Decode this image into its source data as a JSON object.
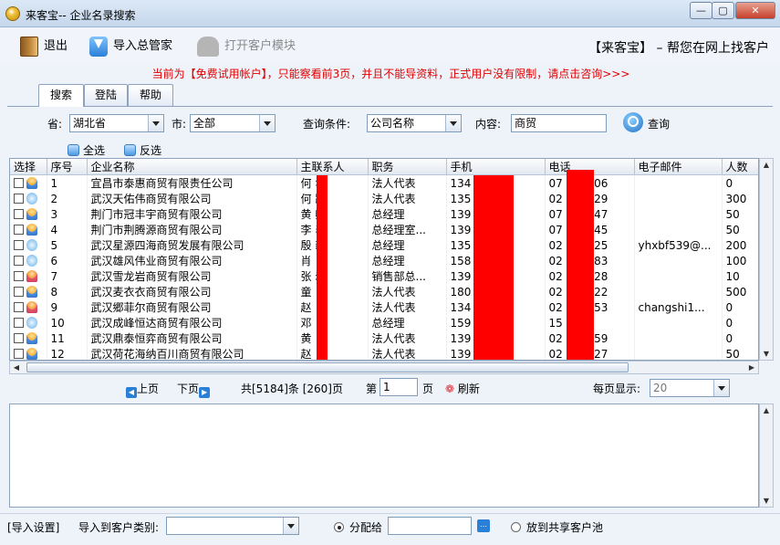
{
  "window": {
    "title": "来客宝-- 企业名录搜索",
    "min_label": "—",
    "max_label": "▢",
    "close_label": "✕"
  },
  "toolbar": {
    "exit_label": "退出",
    "import_label": "导入总管家",
    "open_module_label": "打开客户模块",
    "slogan": "【来客宝】 –  帮您在网上找客户"
  },
  "notice": "当前为【免费试用帐户】，只能察看前3页，并且不能导资料，正式用户没有限制，请点击咨询>>>",
  "tabs": [
    {
      "label": "搜索",
      "active": true
    },
    {
      "label": "登陆",
      "active": false
    },
    {
      "label": "帮助",
      "active": false
    }
  ],
  "search": {
    "province_label": "省:",
    "province_value": "湖北省",
    "city_label": "市:",
    "city_value": "全部",
    "condition_label": "查询条件:",
    "condition_value": "公司名称",
    "content_label": "内容:",
    "content_value": "商贸",
    "search_button": "查询",
    "select_all": "全选",
    "invert_select": "反选"
  },
  "grid": {
    "columns": [
      "选择",
      "序号",
      "企业名称",
      "主联系人",
      "职务",
      "手机",
      "电话",
      "电子邮件",
      "人数"
    ],
    "rows": [
      {
        "icon": "user",
        "no": "1",
        "name": "宜昌市泰惠商贸有限责任公司",
        "contact": "何   华",
        "title": "法人代表",
        "mobile": "134            23",
        "phone": "07            282106",
        "email": "",
        "count": "0"
      },
      {
        "icon": "star",
        "no": "2",
        "name": "武汉天佑伟商贸有限公司",
        "contact": "何   路",
        "title": "法人代表",
        "mobile": "135            83",
        "phone": "02            119329",
        "email": "",
        "count": "300"
      },
      {
        "icon": "user",
        "no": "3",
        "name": "荆门市冠丰宇商贸有限公司",
        "contact": "黄   卿",
        "title": "总经理",
        "mobile": "139            76",
        "phone": "07            211347",
        "email": "",
        "count": "50"
      },
      {
        "icon": "user",
        "no": "4",
        "name": "荆门市荆腾源商贸有限公司",
        "contact": "李   表",
        "title": "总经理室...",
        "mobile": "139            68",
        "phone": "07            219845",
        "email": "",
        "count": "50"
      },
      {
        "icon": "star",
        "no": "5",
        "name": "武汉星源四海商贸发展有限公司",
        "contact": "殷   新",
        "title": "总经理",
        "mobile": "135            23",
        "phone": "02            158925",
        "email": "yhxbf539@...",
        "count": "200"
      },
      {
        "icon": "star",
        "no": "6",
        "name": "武汉雄风伟业商贸有限公司",
        "contact": "肖",
        "title": "总经理",
        "mobile": "158            02",
        "phone": "02            252183",
        "email": "",
        "count": "100"
      },
      {
        "icon": "female",
        "no": "7",
        "name": "武汉雪龙岩商贸有限公司",
        "contact": "张   岩",
        "title": "销售部总...",
        "mobile": "139            14",
        "phone": "02            010528",
        "email": "",
        "count": "10"
      },
      {
        "icon": "user",
        "no": "8",
        "name": "武汉麦衣衣商贸有限公司",
        "contact": "童",
        "title": "法人代表",
        "mobile": "180            81",
        "phone": "02            563022",
        "email": "",
        "count": "500"
      },
      {
        "icon": "female",
        "no": "9",
        "name": "武汉郷菲尔商贸有限公司",
        "contact": "赵",
        "title": "法人代表",
        "mobile": "134            03",
        "phone": "02            740353",
        "email": "changshi1...",
        "count": "0"
      },
      {
        "icon": "star",
        "no": "10",
        "name": "武汉成峰恒达商贸有限公司",
        "contact": "邓",
        "title": "总经理",
        "mobile": "159            82",
        "phone": "15            93",
        "email": "",
        "count": "0"
      },
      {
        "icon": "user",
        "no": "11",
        "name": "武汉鼎泰恒弈商贸有限公司",
        "contact": "黄",
        "title": "法人代表",
        "mobile": "139            55",
        "phone": "02            385559",
        "email": "",
        "count": "0"
      },
      {
        "icon": "user",
        "no": "12",
        "name": "武汉荷花海纳百川商贸有限公司",
        "contact": "赵   良",
        "title": "法人代表",
        "mobile": "139            98",
        "phone": "02            376527",
        "email": "",
        "count": "50"
      }
    ]
  },
  "pager": {
    "prev": "上页",
    "next": "下页",
    "summary": "共[5184]条 [260]页",
    "page_label": "第",
    "page_value": "1",
    "page_unit": "页",
    "refresh": "刷新",
    "per_page_label": "每页显示:",
    "per_page_value": "20"
  },
  "bottom": {
    "import_settings": "[导入设置]",
    "category_label": "导入到客户类别:",
    "category_value": "",
    "assign_label": "分配给",
    "assign_value": "",
    "shared_label": "放到共享客户池"
  }
}
